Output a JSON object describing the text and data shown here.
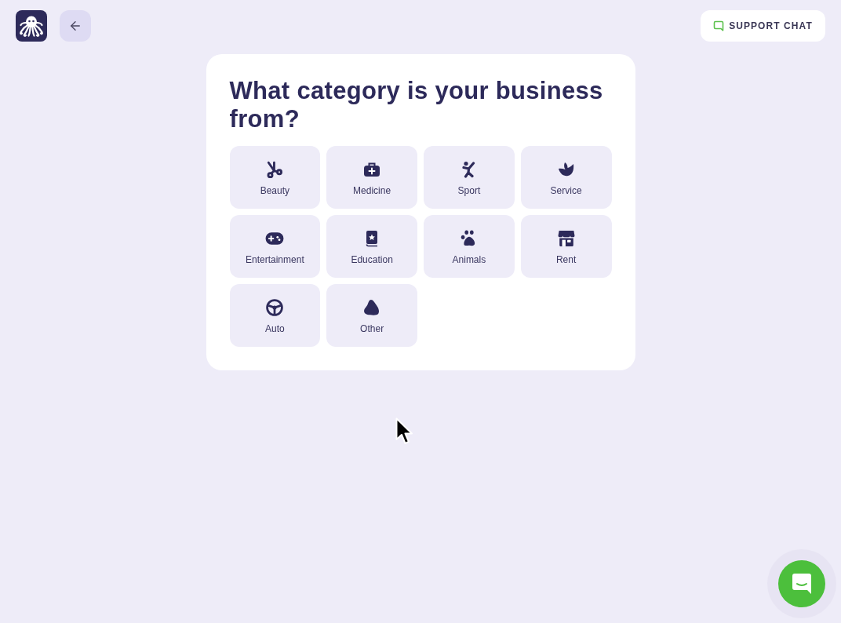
{
  "header": {
    "support_chat_button": {
      "label": "SUPPORT CHAT"
    }
  },
  "question": {
    "title": "What category is your business from?"
  },
  "categories": [
    {
      "label": "Beauty",
      "selected": false
    },
    {
      "label": "Medicine",
      "selected": false
    },
    {
      "label": "Sport",
      "selected": false
    },
    {
      "label": "Service",
      "selected": false
    },
    {
      "label": "Entertainment",
      "selected": false
    },
    {
      "label": "Education",
      "selected": false
    },
    {
      "label": "Animals",
      "selected": false
    },
    {
      "label": "Rent",
      "selected": false
    },
    {
      "label": "Auto",
      "selected": false
    },
    {
      "label": "Other",
      "selected": false
    }
  ]
}
